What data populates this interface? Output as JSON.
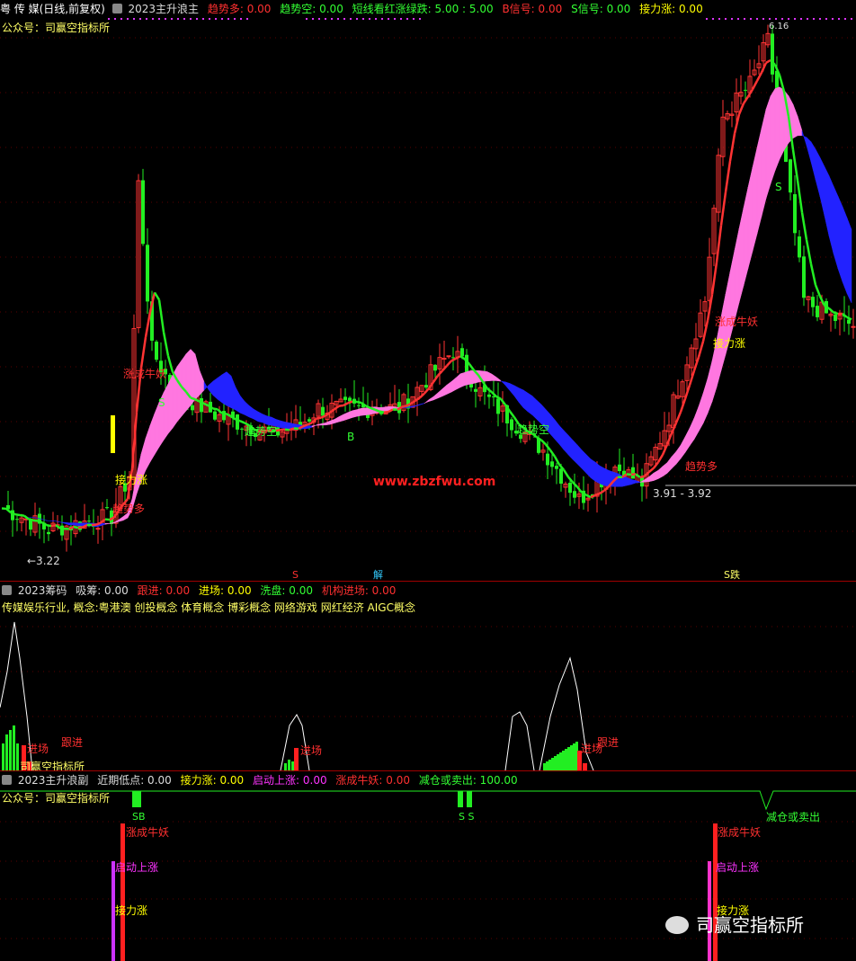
{
  "main_panel": {
    "title_stock": "粤 传 媒(日线,前复权)",
    "indicator_name": "2023主升浪主",
    "params": [
      {
        "label": "趋势多: 0.00",
        "color": "#ff3030"
      },
      {
        "label": "趋势空: 0.00",
        "color": "#33ff33"
      },
      {
        "label": "短线看红涨绿跌: 5.00 : 5.00",
        "color": "#33ff33"
      },
      {
        "label": "B信号: 0.00",
        "color": "#ff3030"
      },
      {
        "label": "S信号: 0.00",
        "color": "#33ff33"
      },
      {
        "label": "接力涨: 0.00",
        "color": "#ffff00"
      }
    ],
    "subtitle": "公众号：司赢空指标所",
    "website": "www.zbzfwu.com",
    "price_annotations": {
      "low_left": "3.22",
      "low_right": "3.91 - 3.92",
      "high": "6.16"
    },
    "labels": [
      "涨成牛妖",
      "接力涨",
      "趋势多",
      "趋势空",
      "S",
      "B",
      "解",
      "涨成牛妖",
      "接力涨",
      "趋势多",
      "S",
      "趋势空"
    ],
    "bottom_markers": [
      "S",
      "解",
      "S跌"
    ]
  },
  "chip_panel": {
    "indicator_name": "2023筹码",
    "params": [
      {
        "label": "吸筹: 0.00",
        "color": "#dddddd"
      },
      {
        "label": "跟进: 0.00",
        "color": "#ff3030"
      },
      {
        "label": "进场: 0.00",
        "color": "#ffff00"
      },
      {
        "label": "洗盘: 0.00",
        "color": "#33ff33"
      },
      {
        "label": "机构进场: 0.00",
        "color": "#ff3030"
      }
    ],
    "industry_line": "传媒娱乐行业,  概念:粤港澳 创投概念 体育概念 博彩概念 网络游戏 网红经济 AIGC概念",
    "labels": [
      "进场",
      "跟进",
      "司赢空指标所",
      "进场",
      "进场",
      "跟进"
    ]
  },
  "sub_panel": {
    "indicator_name": "2023主升浪副",
    "params": [
      {
        "label": "近期低点: 0.00",
        "color": "#dddddd"
      },
      {
        "label": "接力涨: 0.00",
        "color": "#ffff00"
      },
      {
        "label": "启动上涨: 0.00",
        "color": "#ff33ff"
      },
      {
        "label": "涨成牛妖: 0.00",
        "color": "#ff3030"
      },
      {
        "label": "减仓或卖出: 100.00",
        "color": "#33ff33"
      }
    ],
    "subtitle": "公众号：司赢空指标所",
    "labels": [
      "SB",
      "S S",
      "减仓或卖出",
      "涨成牛妖",
      "启动上涨",
      "接力涨",
      "涨成牛妖",
      "启动上涨",
      "接力涨"
    ],
    "watermark": "司赢空指标所"
  },
  "colors": {
    "up": "#ff3333",
    "down": "#22ee22",
    "pink": "#ff77e0",
    "blue": "#2222ff",
    "yellow": "#ffff00",
    "magenta": "#dd33ff"
  },
  "chart_data": {
    "type": "candlestick",
    "price_range": [
      3.0,
      6.3
    ],
    "markers": {
      "low_left": 3.22,
      "low_right": 3.91,
      "high": 6.16
    }
  }
}
